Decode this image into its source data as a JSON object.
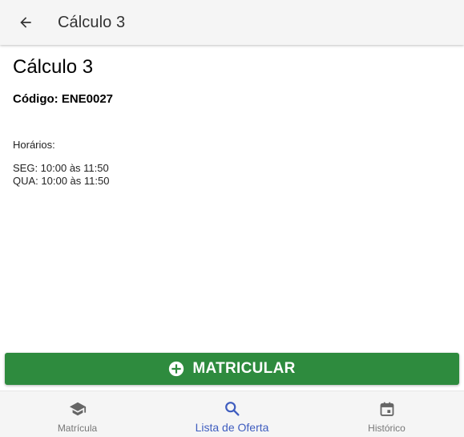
{
  "appbar": {
    "title": "Cálculo 3",
    "back_icon": "arrow-left-icon"
  },
  "course": {
    "title": "Cálculo 3",
    "code_line": "Código: ENE0027",
    "schedule_label": "Horários:",
    "schedule": [
      "SEG: 10:00 às 11:50",
      "QUA: 10:00 às 11:50"
    ]
  },
  "enroll_button": {
    "label": "MATRICULAR",
    "icon": "plus-circle-icon",
    "color": "#2e8b3e"
  },
  "bottom_nav": {
    "items": [
      {
        "label": "Matrícula",
        "icon": "graduation-cap-icon",
        "active": false
      },
      {
        "label": "Lista de Oferta",
        "icon": "search-icon",
        "active": true
      },
      {
        "label": "Histórico",
        "icon": "calendar-icon",
        "active": false
      }
    ],
    "active_color": "#3f5dbf",
    "inactive_color": "#777777"
  }
}
